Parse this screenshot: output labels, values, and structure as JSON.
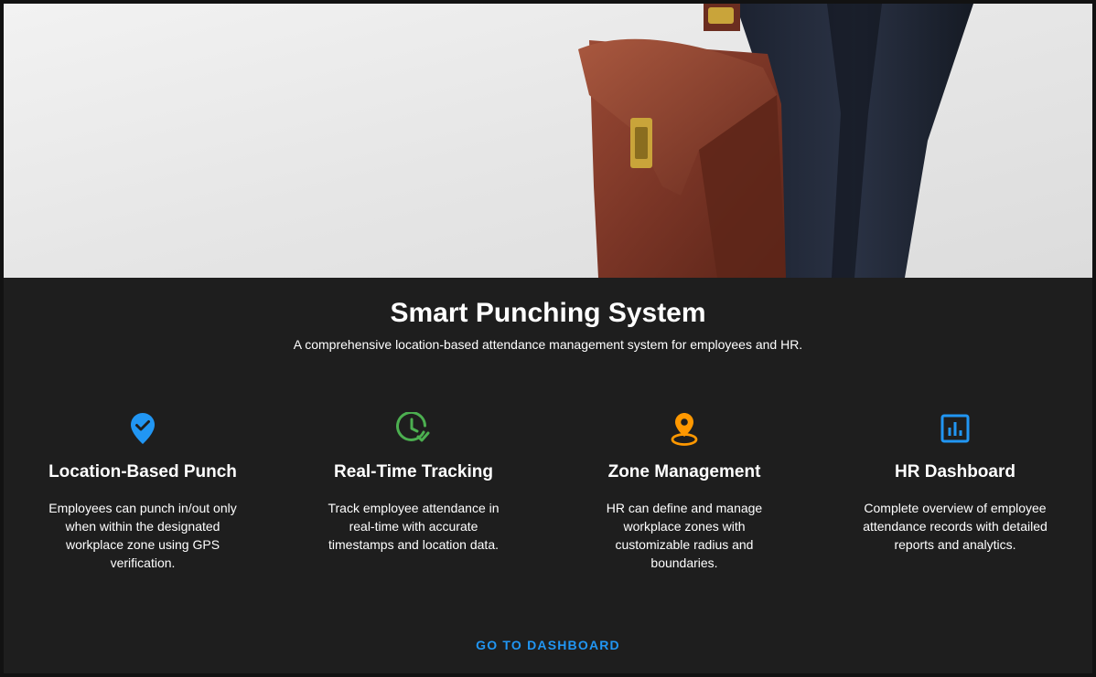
{
  "hero": {
    "image_alt": "person carrying a brown leather briefcase"
  },
  "header": {
    "title": "Smart Punching System",
    "subtitle": "A comprehensive location-based attendance management system for employees and HR."
  },
  "features": [
    {
      "icon": "location-check-icon",
      "icon_color": "#2196f3",
      "title": "Location-Based Punch",
      "description": "Employees can punch in/out only when within the designated workplace zone using GPS verification."
    },
    {
      "icon": "clock-check-icon",
      "icon_color": "#4caf50",
      "title": "Real-Time Tracking",
      "description": "Track employee attendance in real-time with accurate timestamps and location data."
    },
    {
      "icon": "pin-drop-icon",
      "icon_color": "#ff9800",
      "title": "Zone Management",
      "description": "HR can define and manage workplace zones with customizable radius and boundaries."
    },
    {
      "icon": "analytics-icon",
      "icon_color": "#2196f3",
      "title": "HR Dashboard",
      "description": "Complete overview of employee attendance records with detailed reports and analytics."
    }
  ],
  "cta": {
    "label": "GO TO DASHBOARD",
    "color": "#2196f3"
  },
  "colors": {
    "background": "#1e1e1e",
    "text": "#ffffff"
  }
}
